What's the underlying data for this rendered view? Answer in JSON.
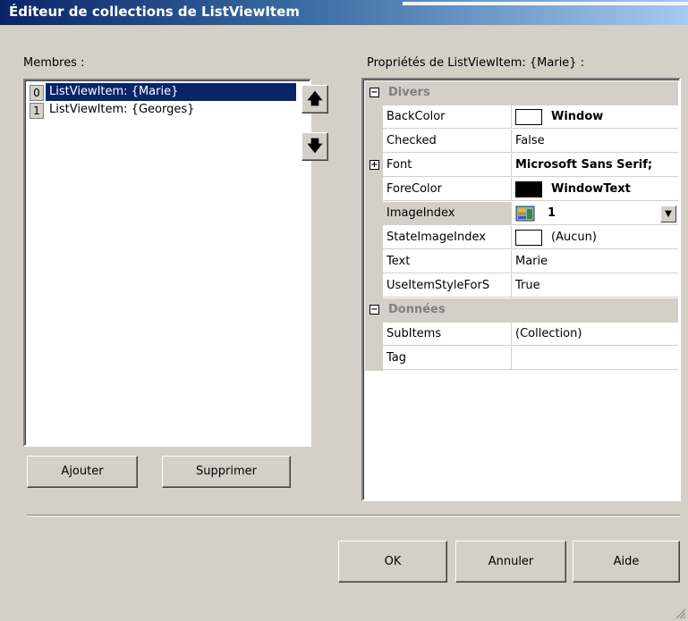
{
  "window": {
    "title": "Éditeur de collections de ListViewItem"
  },
  "members": {
    "label": "Membres :",
    "items": [
      {
        "index": "0",
        "text": "ListViewItem: {Marie}",
        "selected": true
      },
      {
        "index": "1",
        "text": "ListViewItem: {Georges}",
        "selected": false
      }
    ],
    "up_icon": "arrow-up-icon",
    "down_icon": "arrow-down-icon",
    "add_label": "Ajouter",
    "remove_label": "Supprimer"
  },
  "properties": {
    "label": "Propriétés de ListViewItem: {Marie} :",
    "categories": [
      {
        "name": "Divers",
        "expander": "⊟"
      },
      {
        "name": "Données",
        "expander": "⊟"
      }
    ],
    "rows": [
      {
        "name": "BackColor",
        "value": "Window",
        "swatch": "#ffffff"
      },
      {
        "name": "Checked",
        "value": "False"
      },
      {
        "name": "Font",
        "value": "Microsoft Sans Serif;",
        "expander": "+"
      },
      {
        "name": "ForeColor",
        "value": "WindowText",
        "swatch": "#000000"
      },
      {
        "name": "ImageIndex",
        "value": "1"
      },
      {
        "name": "StateImageIndex",
        "value": "(Aucun)",
        "swatch": "#ffffff"
      },
      {
        "name": "Text",
        "value": "Marie"
      },
      {
        "name": "UseItemStyleForS",
        "value": "True"
      },
      {
        "name": "SubItems",
        "value": "(Collection)"
      },
      {
        "name": "Tag",
        "value": ""
      }
    ]
  },
  "buttons": {
    "ok": "OK",
    "cancel": "Annuler",
    "help": "Aide"
  },
  "colors": {
    "titlebar_start": "#0a246a",
    "titlebar_end": "#a6caf0",
    "selection": "#0a246a",
    "face": "#d4d0c8"
  }
}
